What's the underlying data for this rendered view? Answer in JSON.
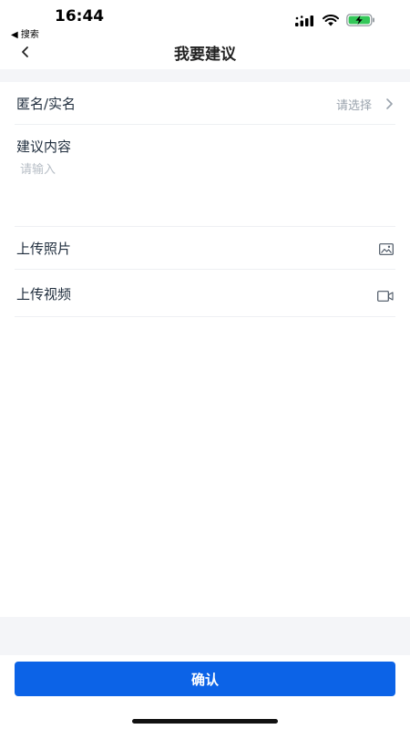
{
  "status_bar": {
    "time": "16:44",
    "back_app": "◀ 搜索",
    "icons": [
      "signal-icon",
      "wifi-icon",
      "battery-charging-icon"
    ]
  },
  "nav": {
    "title": "我要建议",
    "back_icon": "chevron-left-icon"
  },
  "form": {
    "anonymity": {
      "label": "匿名/实名",
      "value_placeholder": "请选择",
      "icon": "chevron-right-icon"
    },
    "content": {
      "label": "建议内容",
      "placeholder": "请输入"
    },
    "photo": {
      "label": "上传照片",
      "icon": "image-icon"
    },
    "video": {
      "label": "上传视频",
      "icon": "video-camera-icon"
    }
  },
  "footer": {
    "confirm_label": "确认"
  },
  "colors": {
    "primary": "#0c63e7",
    "background_band": "#f4f5f8",
    "divider": "#eef0f3"
  }
}
